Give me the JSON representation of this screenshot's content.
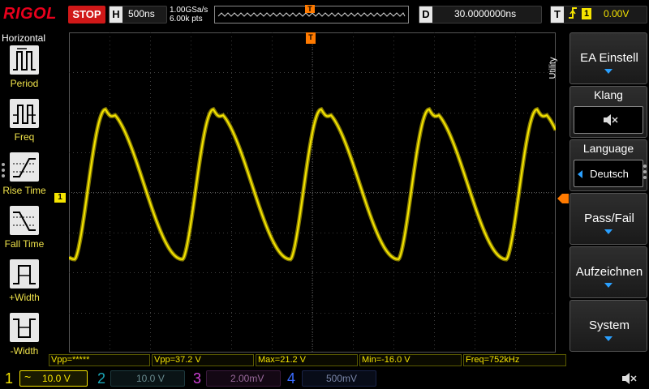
{
  "brand": "RIGOL",
  "run_state": "STOP",
  "timebase": {
    "letter": "H",
    "value": "500ns"
  },
  "acquisition": {
    "sample_rate": "1.00GSa/s",
    "memory_depth": "6.00k pts"
  },
  "trigger_overview": {
    "marker": "T"
  },
  "delay": {
    "letter": "D",
    "value": "30.0000000ns"
  },
  "trigger": {
    "letter": "T",
    "edge": "rising-edge-icon",
    "source": "1",
    "level": "0.00V"
  },
  "horizontal_menu": {
    "title": "Horizontal",
    "items": [
      {
        "label": "Period",
        "icon": "period-icon"
      },
      {
        "label": "Freq",
        "icon": "frequency-icon"
      },
      {
        "label": "Rise Time",
        "icon": "rise-time-icon"
      },
      {
        "label": "Fall Time",
        "icon": "fall-time-icon"
      },
      {
        "label": "+Width",
        "icon": "positive-width-icon"
      },
      {
        "label": "-Width",
        "icon": "negative-width-icon"
      }
    ]
  },
  "grid_markers": {
    "ch1_ground": "1",
    "trigger_position": "T"
  },
  "utility_menu": {
    "tab_label": "Utility",
    "buttons": [
      {
        "label": "EA Einstell",
        "kind": "button"
      },
      {
        "label": "Klang",
        "kind": "split",
        "value_icon": "speaker-muted-icon"
      },
      {
        "label": "Language",
        "kind": "split",
        "value": "Deutsch"
      },
      {
        "label": "Pass/Fail",
        "kind": "button"
      },
      {
        "label": "Aufzeichnen",
        "kind": "button"
      },
      {
        "label": "System",
        "kind": "button"
      }
    ]
  },
  "measurements": [
    "Vpp=*****",
    "Vpp=37.2 V",
    "Max=21.2 V",
    "Min=-16.0 V",
    "Freq=752kHz"
  ],
  "channels": [
    {
      "num": "1",
      "coupling_icon": "ac-coupling-icon",
      "coupling_symbol": "~",
      "scale": "10.0 V",
      "color": "#f5e400",
      "active": true
    },
    {
      "num": "2",
      "scale": "10.0 V",
      "color": "#1aa7b8",
      "active": false
    },
    {
      "num": "3",
      "scale": "2.00mV",
      "color": "#d040d8",
      "active": false
    },
    {
      "num": "4",
      "scale": "500mV",
      "color": "#3a6cff",
      "active": false
    }
  ],
  "waveform": {
    "channel": "1",
    "color": "#f5e400",
    "frequency": "752kHz",
    "max": "21.2 V",
    "min": "-16.0 V"
  },
  "colors": {
    "ch1": "#f5e400",
    "trigger_marker": "#ff7a00",
    "stop": "#d01818",
    "accent": "#2aa0ff"
  }
}
